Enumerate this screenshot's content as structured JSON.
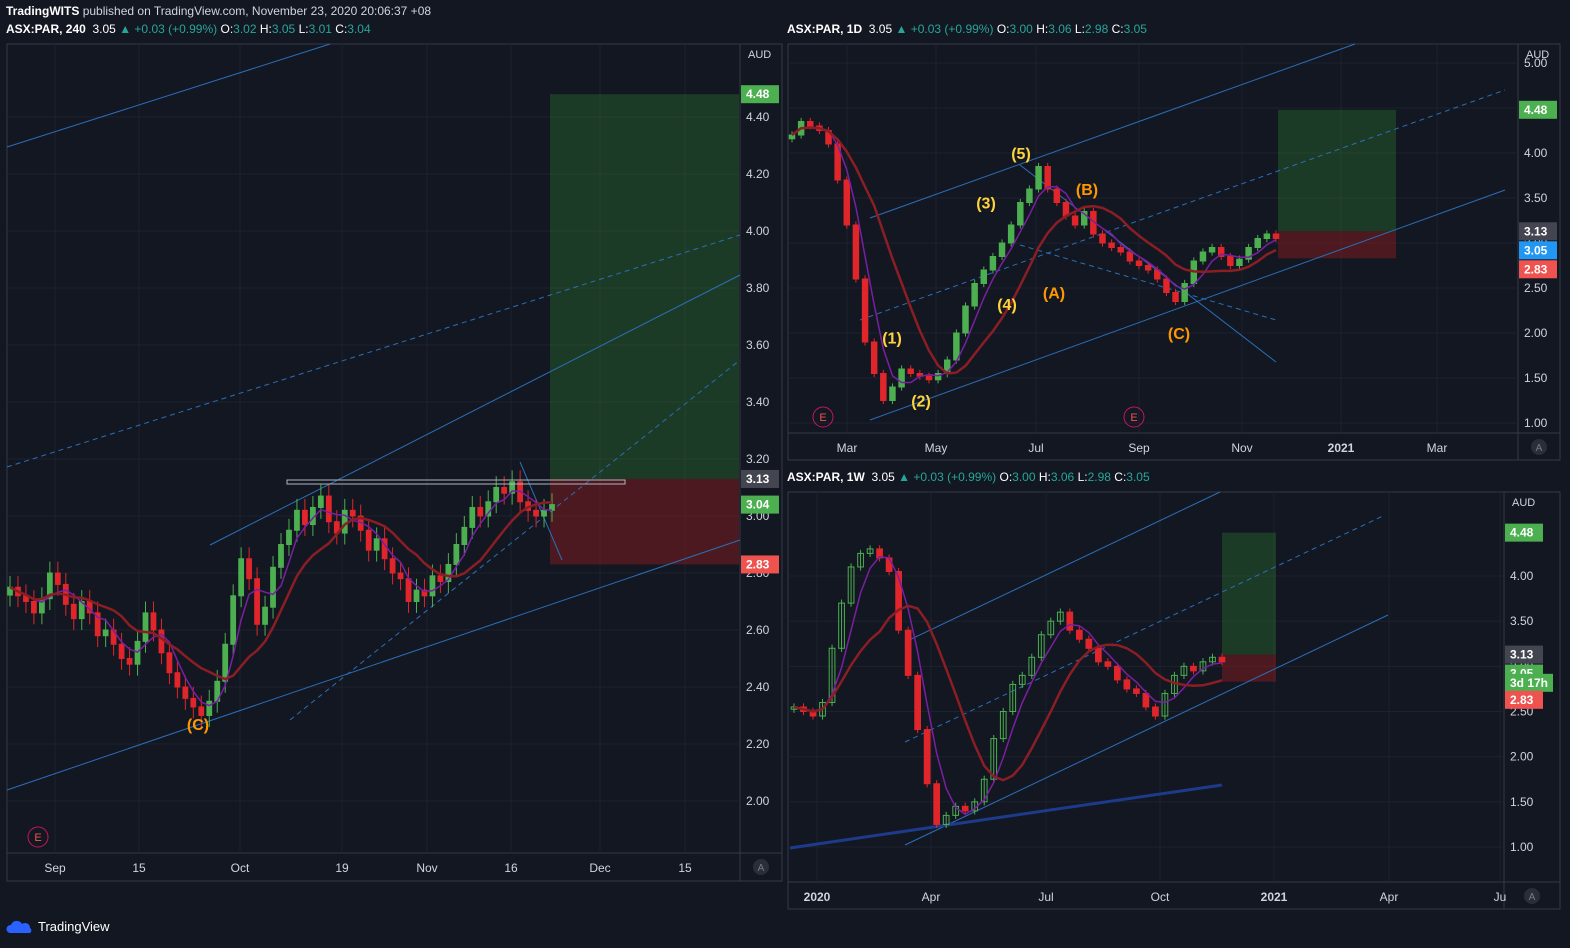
{
  "header": {
    "publisher": "TradingWITS",
    "published_text": "published on TradingView.com, November 23, 2020 20:06:37 +08"
  },
  "footer": {
    "brand": "TradingView",
    "logo_icon": "tradingview-cloud-icon"
  },
  "colors": {
    "background": "#131722",
    "grid": "#1e222d",
    "up": "#26a69a",
    "down": "#ef5350",
    "up_candle": "#4caf50",
    "down_candle": "#e0262a",
    "channel": "#2962ff",
    "wave_yellow": "#ffd43b",
    "wave_orange": "#ff9800",
    "target": "#4caf50",
    "stop": "#ef5350",
    "current": "#2196f3"
  },
  "panels": [
    {
      "id": "h4",
      "symbol": "ASX:PAR, 240",
      "last": "3.05",
      "change": "+0.03 (+0.99%)",
      "ohlc": {
        "O": "3.02",
        "H": "3.05",
        "L": "3.01",
        "C": "3.04"
      },
      "currency": "AUD",
      "events_icon": "E",
      "auto_scale_icon": "A"
    },
    {
      "id": "d1",
      "symbol": "ASX:PAR, 1D",
      "last": "3.05",
      "change": "+0.03 (+0.99%)",
      "ohlc": {
        "O": "3.00",
        "H": "3.06",
        "L": "2.98",
        "C": "3.05"
      },
      "currency": "AUD",
      "events_icon": "E",
      "auto_scale_icon": "A"
    },
    {
      "id": "w1",
      "symbol": "ASX:PAR, 1W",
      "last": "3.05",
      "change": "+0.03 (+0.99%)",
      "ohlc": {
        "O": "3.00",
        "H": "3.06",
        "L": "2.98",
        "C": "3.05"
      },
      "currency": "AUD",
      "auto_scale_icon": "A"
    }
  ],
  "chart_data": [
    {
      "type": "candlestick",
      "panel": "h4",
      "x_tick_labels": [
        "Sep",
        "15",
        "Oct",
        "19",
        "Nov",
        "16",
        "Dec",
        "15"
      ],
      "y_tick_labels": [
        "4.40",
        "4.20",
        "4.00",
        "3.80",
        "3.60",
        "3.40",
        "3.20",
        "3.00",
        "2.80",
        "2.60",
        "2.40",
        "2.20",
        "2.00"
      ],
      "ylim": [
        1.8,
        4.6
      ],
      "price_labels": [
        {
          "text": "4.48",
          "value": 4.48,
          "role": "target"
        },
        {
          "text": "3.13",
          "value": 3.13,
          "role": "entry"
        },
        {
          "text": "3.04",
          "value": 3.04,
          "role": "last"
        },
        {
          "text": "2.83",
          "value": 2.83,
          "role": "stop"
        }
      ],
      "annotations": [
        {
          "text": "(C)",
          "value": 2.27,
          "color": "orange"
        }
      ],
      "closes": [
        2.75,
        2.72,
        2.7,
        2.66,
        2.71,
        2.8,
        2.76,
        2.69,
        2.64,
        2.7,
        2.66,
        2.58,
        2.6,
        2.55,
        2.5,
        2.48,
        2.56,
        2.66,
        2.6,
        2.52,
        2.45,
        2.4,
        2.36,
        2.33,
        2.3,
        2.35,
        2.42,
        2.55,
        2.72,
        2.85,
        2.78,
        2.62,
        2.68,
        2.82,
        2.9,
        2.95,
        3.02,
        2.97,
        3.03,
        3.07,
        2.98,
        2.94,
        3.02,
        3.0,
        2.95,
        2.88,
        2.92,
        2.85,
        2.8,
        2.78,
        2.7,
        2.74,
        2.72,
        2.79,
        2.77,
        2.83,
        2.9,
        2.96,
        3.03,
        3.0,
        3.05,
        3.1,
        3.08,
        3.12,
        3.05,
        3.02,
        3.0,
        3.02,
        3.04
      ]
    },
    {
      "type": "candlestick",
      "panel": "d1",
      "x_tick_labels": [
        "Mar",
        "May",
        "Jul",
        "Sep",
        "Nov",
        "2021",
        "Mar"
      ],
      "y_tick_labels": [
        "5.00",
        "4.50",
        "4.00",
        "3.50",
        "3.00",
        "2.50",
        "2.00",
        "1.50",
        "1.00"
      ],
      "ylim": [
        0.9,
        5.2
      ],
      "price_labels": [
        {
          "text": "4.48",
          "value": 4.48,
          "role": "target"
        },
        {
          "text": "3.13",
          "value": 3.13,
          "role": "entry"
        },
        {
          "text": "3.05",
          "value": 3.05,
          "role": "last"
        },
        {
          "text": "2.83",
          "value": 2.83,
          "role": "stop"
        }
      ],
      "annotations": [
        {
          "text": "(1)",
          "value": 1.95,
          "color": "yellow"
        },
        {
          "text": "(2)",
          "value": 1.25,
          "color": "yellow"
        },
        {
          "text": "(3)",
          "value": 3.45,
          "color": "yellow"
        },
        {
          "text": "(4)",
          "value": 2.32,
          "color": "yellow"
        },
        {
          "text": "(5)",
          "value": 4.0,
          "color": "yellow"
        },
        {
          "text": "(A)",
          "value": 2.45,
          "color": "orange"
        },
        {
          "text": "(B)",
          "value": 3.6,
          "color": "orange"
        },
        {
          "text": "(C)",
          "value": 2.0,
          "color": "orange"
        }
      ],
      "closes": [
        4.2,
        4.35,
        4.3,
        4.25,
        4.1,
        3.7,
        3.2,
        2.6,
        1.9,
        1.55,
        1.25,
        1.4,
        1.6,
        1.55,
        1.52,
        1.48,
        1.55,
        1.7,
        2.0,
        2.3,
        2.55,
        2.7,
        2.85,
        3.0,
        3.2,
        3.45,
        3.6,
        3.85,
        3.6,
        3.45,
        3.3,
        3.2,
        3.35,
        3.1,
        3.0,
        2.95,
        2.9,
        2.8,
        2.75,
        2.7,
        2.6,
        2.45,
        2.35,
        2.55,
        2.8,
        2.9,
        2.95,
        2.85,
        2.75,
        2.82,
        2.95,
        3.05,
        3.1,
        3.05
      ]
    },
    {
      "type": "candlestick",
      "panel": "w1",
      "x_tick_labels": [
        "2020",
        "Apr",
        "Jul",
        "Oct",
        "2021",
        "Apr",
        "Ju"
      ],
      "y_tick_labels": [
        "4.00",
        "3.50",
        "3.00",
        "2.50",
        "2.00",
        "1.50",
        "1.00"
      ],
      "ylim": [
        0.8,
        4.7
      ],
      "price_labels": [
        {
          "text": "4.48",
          "value": 4.48,
          "role": "target"
        },
        {
          "text": "3.13",
          "value": 3.13,
          "role": "entry"
        },
        {
          "text": "3.05",
          "value": 3.05,
          "role": "last"
        },
        {
          "text": "3d 17h",
          "value": 2.92,
          "role": "countdown"
        },
        {
          "text": "2.83",
          "value": 2.83,
          "role": "stop"
        }
      ],
      "closes": [
        2.55,
        2.5,
        2.45,
        2.6,
        3.2,
        3.7,
        4.1,
        4.25,
        4.3,
        4.2,
        4.05,
        3.4,
        2.9,
        2.3,
        1.7,
        1.25,
        1.35,
        1.45,
        1.4,
        1.5,
        1.75,
        2.2,
        2.5,
        2.8,
        2.9,
        3.1,
        3.35,
        3.5,
        3.6,
        3.4,
        3.3,
        3.2,
        3.05,
        3.0,
        2.85,
        2.75,
        2.7,
        2.55,
        2.45,
        2.7,
        2.9,
        3.0,
        2.95,
        3.05,
        3.1,
        3.05
      ]
    }
  ]
}
